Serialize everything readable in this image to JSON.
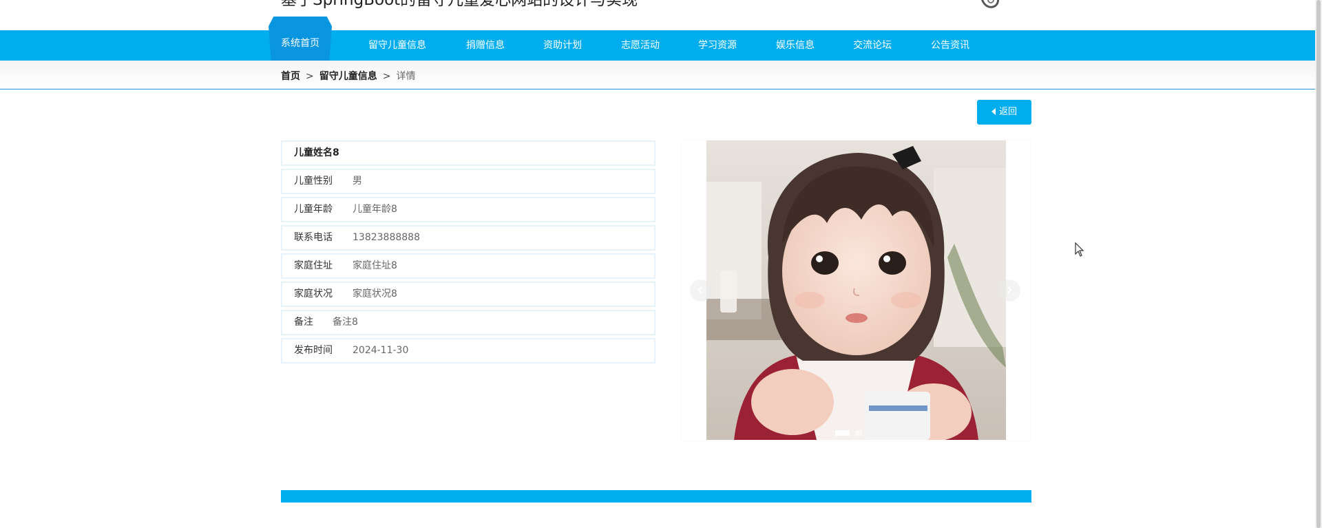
{
  "header": {
    "title": "基于SpringBoot的留守儿童爱心网站的设计与实现"
  },
  "nav": {
    "items": [
      {
        "label": "系统首页",
        "active": true
      },
      {
        "label": "留守儿童信息"
      },
      {
        "label": "捐赠信息"
      },
      {
        "label": "资助计划"
      },
      {
        "label": "志愿活动"
      },
      {
        "label": "学习资源"
      },
      {
        "label": "娱乐信息"
      },
      {
        "label": "交流论坛"
      },
      {
        "label": "公告资讯"
      }
    ]
  },
  "breadcrumb": {
    "home": "首页",
    "separator": ">",
    "section": "留守儿童信息",
    "current": "详情"
  },
  "back_button": {
    "label": "返回",
    "icon": "caret-left-icon"
  },
  "detail": {
    "name": "儿童姓名8",
    "fields": [
      {
        "label": "儿童性别",
        "value": "男"
      },
      {
        "label": "儿童年龄",
        "value": "儿童年龄8"
      },
      {
        "label": "联系电话",
        "value": "13823888888"
      },
      {
        "label": "家庭住址",
        "value": "家庭住址8"
      },
      {
        "label": "家庭状况",
        "value": "家庭状况8"
      },
      {
        "label": "备注",
        "value": "备注8"
      },
      {
        "label": "发布时间",
        "value": "2024-11-30"
      }
    ]
  },
  "carousel": {
    "slide_count": 2,
    "active_slide": 1
  },
  "colors": {
    "primary": "#00aeef",
    "nav_active": "#0a95e0",
    "breadcrumb_line": "#2c8fd6",
    "row_border": "#e6f3fb"
  }
}
